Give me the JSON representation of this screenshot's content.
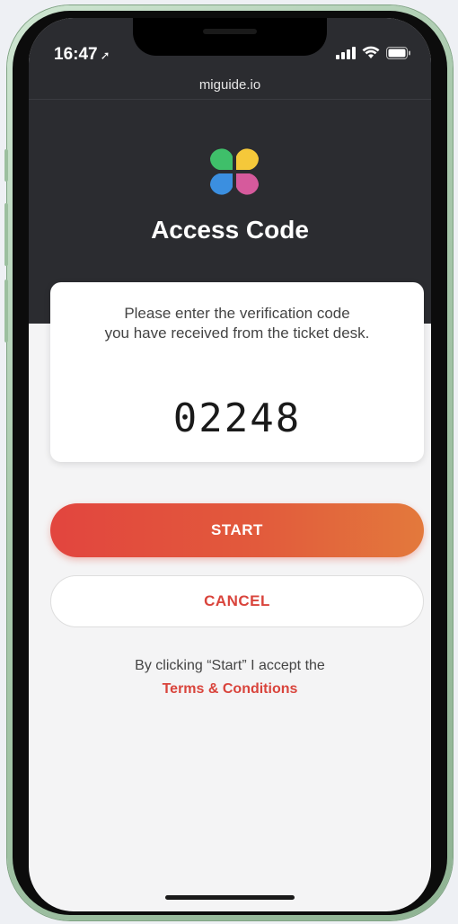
{
  "status_bar": {
    "time": "16:47"
  },
  "browser": {
    "url": "miguide.io"
  },
  "header": {
    "title": "Access Code"
  },
  "card": {
    "instruction_line1": "Please enter the verification code",
    "instruction_line2": "you have received from the ticket desk.",
    "code": "02248"
  },
  "buttons": {
    "start_label": "START",
    "cancel_label": "CANCEL"
  },
  "terms": {
    "text": "By clicking “Start” I accept the",
    "link_label": "Terms & Conditions"
  },
  "colors": {
    "accent": "#d9443c",
    "header_bg": "#2b2c30",
    "logo_green": "#3fbf6a",
    "logo_yellow": "#f5c83a",
    "logo_blue": "#3b8fe0",
    "logo_pink": "#d65a9c"
  },
  "icons": {
    "location": "location-arrow-icon",
    "signal": "cellular-signal-icon",
    "wifi": "wifi-icon",
    "battery": "battery-icon"
  }
}
